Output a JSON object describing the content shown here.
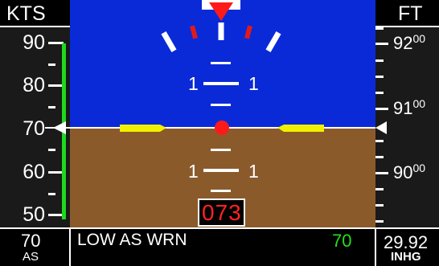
{
  "airspeed_tape": {
    "header": "KTS",
    "labels": [
      "90",
      "80",
      "70",
      "60",
      "50"
    ],
    "current": "70",
    "current_label": "AS"
  },
  "altitude_tape": {
    "header": "FT",
    "labels": [
      {
        "major": "92",
        "minor": "00"
      },
      {
        "major": "91",
        "minor": "00"
      },
      {
        "major": "90",
        "minor": "00"
      }
    ]
  },
  "attitude": {
    "pitch_labels_upper": [
      "1",
      "1"
    ],
    "pitch_labels_lower": [
      "1",
      "1"
    ],
    "sky_color": "#0a2ad8",
    "ground_color": "#8b5a2b",
    "aircraft_symbol_color": "#f0f000",
    "center_dot_color": "#ff1a1a"
  },
  "heading": {
    "value": "073"
  },
  "status_bar": {
    "message": "LOW AS WRN",
    "message_value": "70",
    "baro_value": "29.92",
    "baro_unit": "INHG"
  }
}
